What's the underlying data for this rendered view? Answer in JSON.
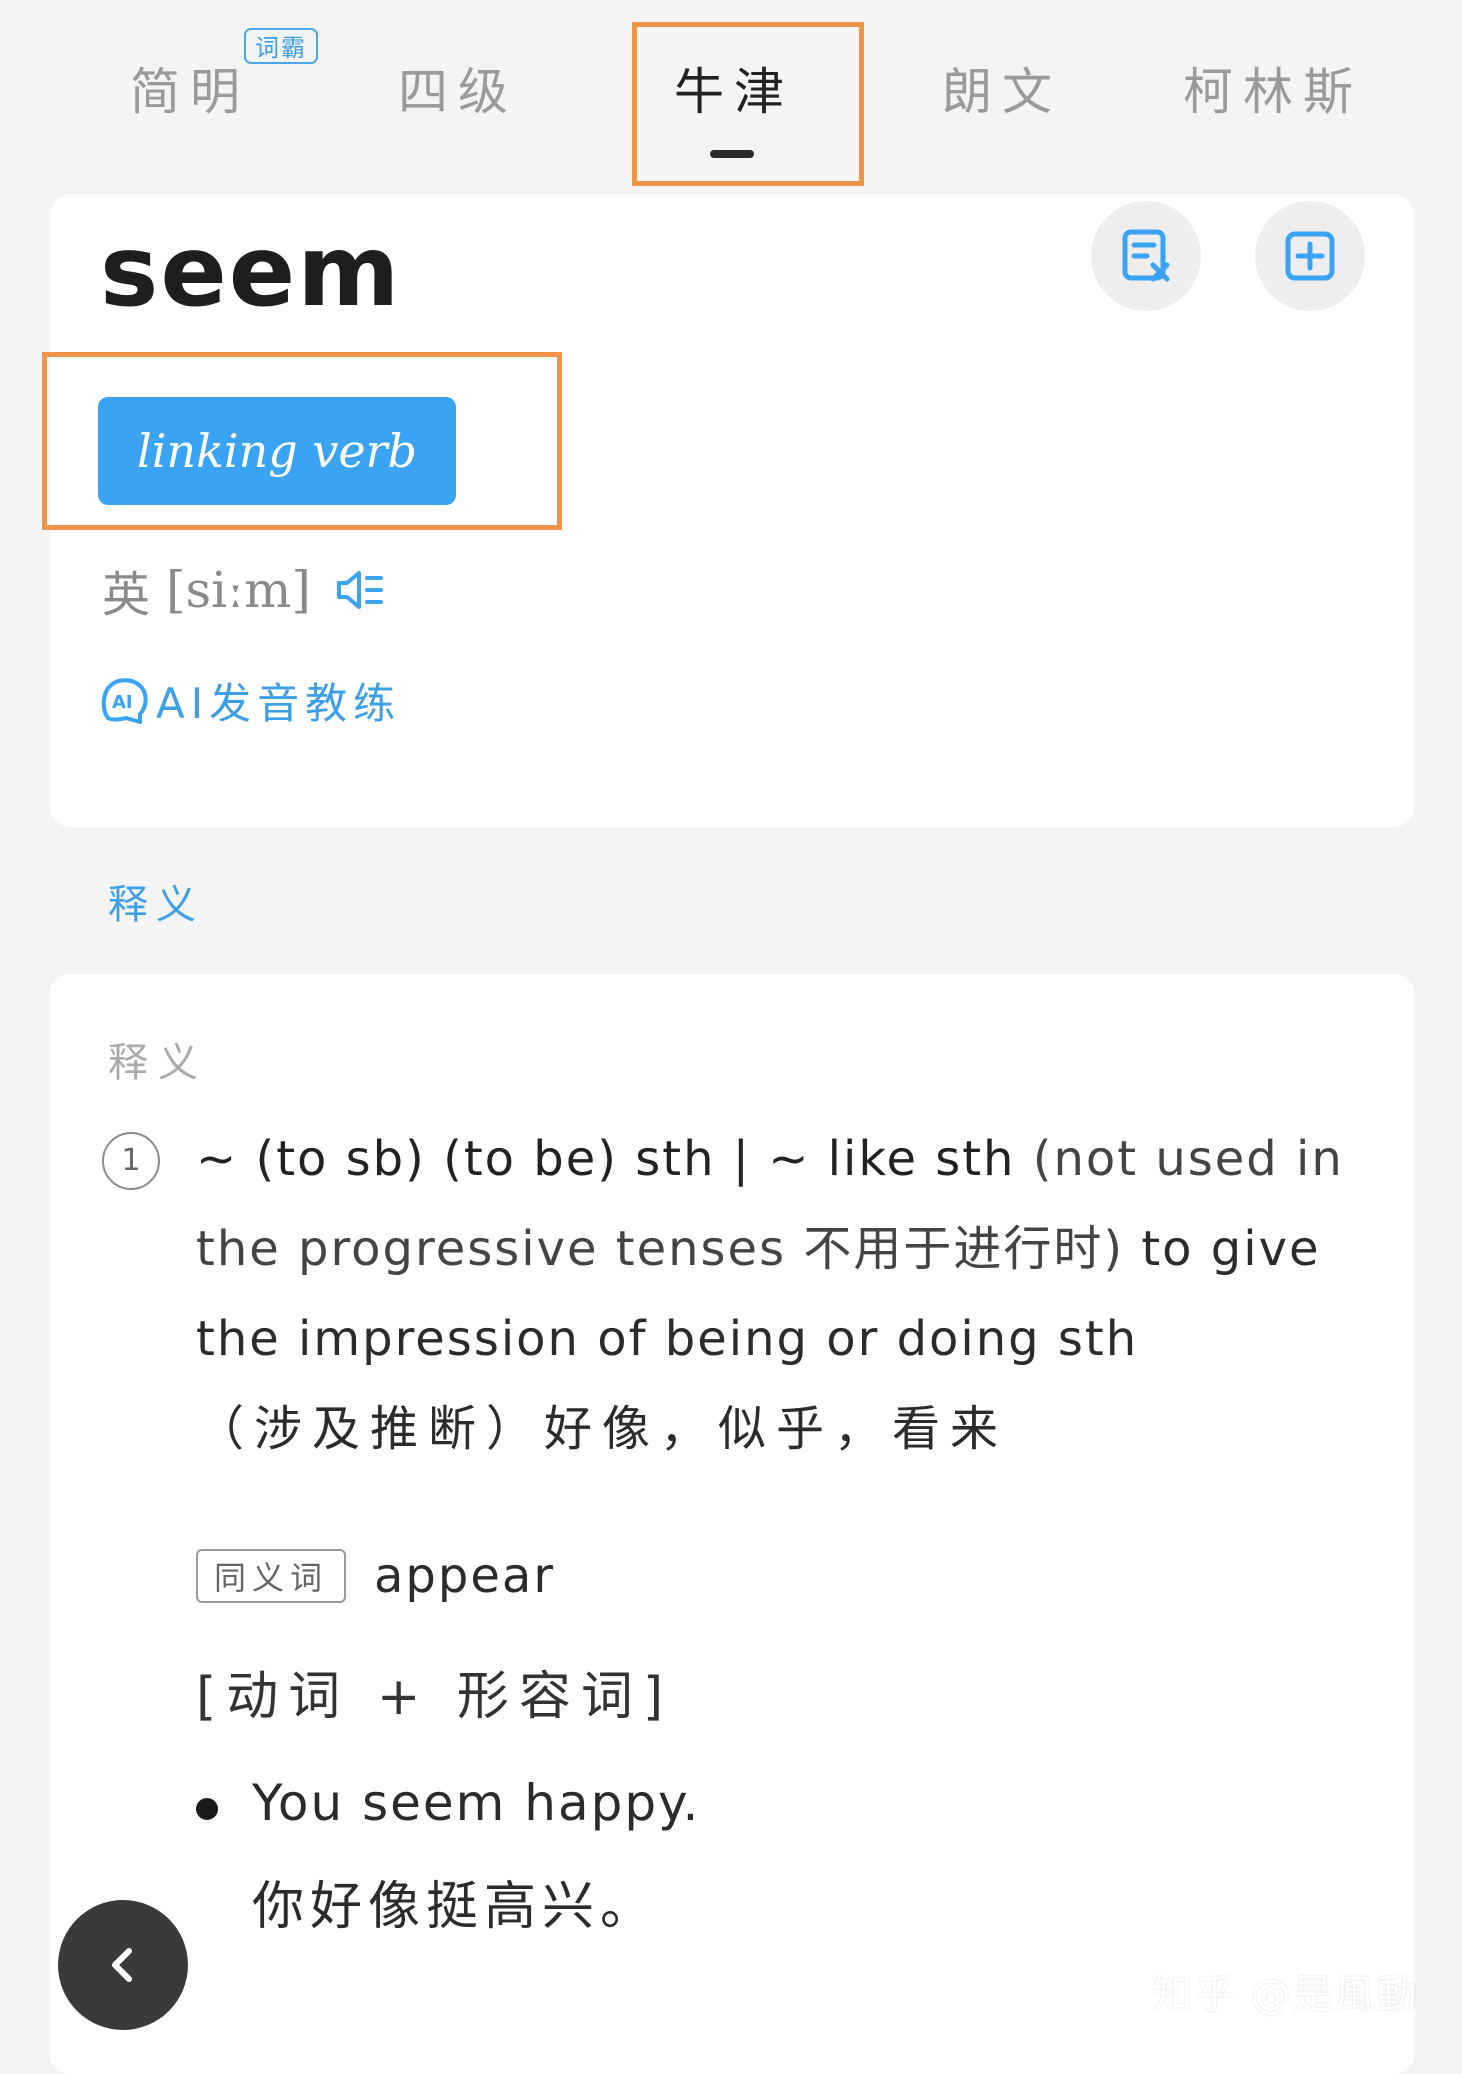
{
  "tabs": [
    {
      "label": "简明",
      "badge": "词霸",
      "active": false
    },
    {
      "label": "四级",
      "active": false
    },
    {
      "label": "牛津",
      "active": true
    },
    {
      "label": "朗文",
      "active": false
    },
    {
      "label": "柯林斯",
      "active": false
    }
  ],
  "entry": {
    "headword": "seem",
    "part_of_speech": "linking verb",
    "phonetic": {
      "region": "英",
      "ipa": "[siːm]"
    },
    "ai_coach_label": "AI发音教练",
    "action_icons": [
      "wordlist-remove-icon",
      "add-to-wordbook-icon"
    ]
  },
  "section_label": "释义",
  "definition_card": {
    "heading": "释义",
    "sense_number": "1",
    "grammar": "~ (to sb) (to be) sth | ~ like sth",
    "usage_note": "(not used in the progressive tenses 不用于进行时)",
    "definition_en": "to give the impression of being or doing sth",
    "definition_cn": "（涉及推断）好像，似乎，看来",
    "synonym_tag": "同义词",
    "synonym": "appear",
    "pattern": "[动词 + 形容词]",
    "example_en": "You seem happy.",
    "example_cn": "你好像挺高兴。"
  },
  "watermark": "知乎 @是風動",
  "colors": {
    "accent": "#3aa3f3",
    "highlight": "#f0944a"
  }
}
